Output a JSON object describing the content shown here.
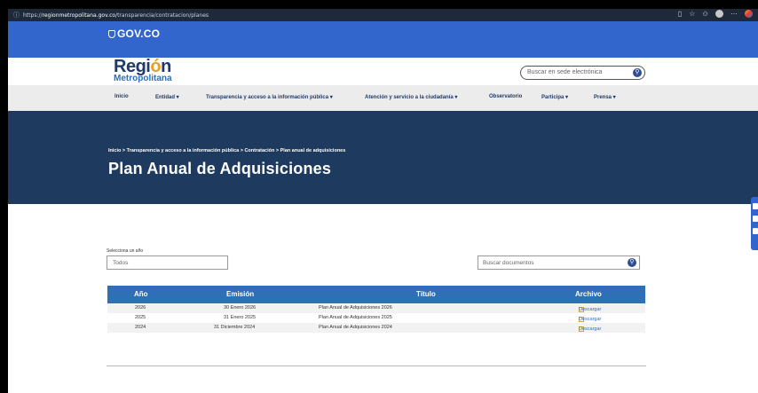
{
  "browser": {
    "url_prefix": "https://",
    "url_domain": "regionmetropolitana.gov.co",
    "url_path": "/transparencia/contratacion/planes"
  },
  "govbar": {
    "logo_text": "GOV.CO"
  },
  "brand": {
    "line1_a": "Regi",
    "line1_b": "ó",
    "line1_c": "n",
    "line2": "Metropolitana"
  },
  "header_search": {
    "placeholder": "Buscar en sede electrónica"
  },
  "nav": [
    {
      "label": "Inicio"
    },
    {
      "label": "Entidad ▾"
    },
    {
      "label": "Transparencia y acceso a la información pública ▾"
    },
    {
      "label": "Atención y servicio a la ciudadanía ▾"
    },
    {
      "label": "Observatorio"
    },
    {
      "label": "Participa ▾"
    },
    {
      "label": "Prensa ▾"
    }
  ],
  "breadcrumb": "Inicio  >  Transparencia y acceso a la información pública  >  Contratación  >  Plan anual de adquisiciones",
  "page_title": "Plan Anual de Adquisiciones",
  "filters": {
    "year_label": "Selecciona un año",
    "year_value": "Todos",
    "doc_search_placeholder": "Buscar documentos"
  },
  "table": {
    "headers": [
      "Año",
      "Emisión",
      "Título",
      "Archivo"
    ],
    "rows": [
      {
        "year": "2026",
        "date": "30 Enero 2026",
        "title": "Plan Anual de Adquisiciones 2026",
        "file": "Descargar"
      },
      {
        "year": "2025",
        "date": "31 Enero 2025",
        "title": "Plan Anual de Adquisiciones 2025",
        "file": "Descargar"
      },
      {
        "year": "2024",
        "date": "31 Diciembre 2024",
        "title": "Plan Anual de Adquisiciones 2024",
        "file": "Descargar"
      }
    ]
  },
  "colors": {
    "gov_blue": "#3366cc",
    "navy": "#1e3a5e",
    "table_header": "#2f6fb5",
    "accent": "#e8a21a"
  }
}
